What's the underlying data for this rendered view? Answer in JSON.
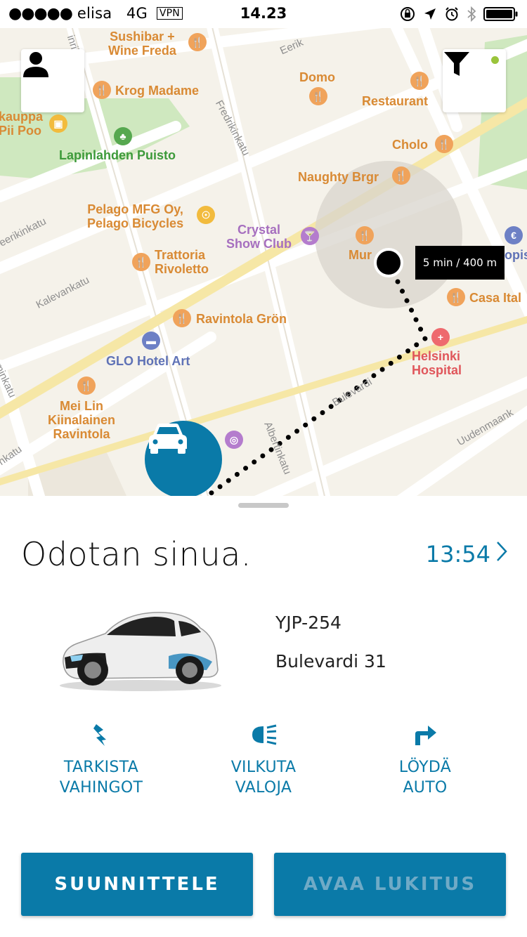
{
  "status_bar": {
    "signal": "●●●●●",
    "carrier": "elisa",
    "network": "4G",
    "vpn": "VPN",
    "time": "14.23"
  },
  "map": {
    "places": {
      "sushibar": "Sushibar +\nWine Freda",
      "krog": "Krog Madame",
      "domo": "Domo",
      "restaurant": "Restaurant",
      "kauppa": "kauppa\nPii Poo",
      "lapinlahden": "Lapinlahden Puisto",
      "cholo": "Cholo",
      "naughty": "Naughty Brgr",
      "pelago": "Pelago MFG Oy,\nPelago Bicycles",
      "crystal": "Crystal\nShow Club",
      "mur": "Mur",
      "opis": "opis",
      "trattoria": "Trattoria\nRivoletto",
      "casa": "Casa Ital",
      "ravintola_gron": "Ravintola Grön",
      "helsinki_hospital": "Helsinki\nHospital",
      "glo": "GLO Hotel Art",
      "meilin": "Mei Lin\nKiinalainen\nRavintola"
    },
    "streets": {
      "eerikinkatu_top": "Eerik",
      "fredrikinkatu": "Fredrikinkatu",
      "eerikinkatu_left": "eerikinkatu",
      "kalevankatu": "Kalevankatu",
      "albertinkatu": "Albertinkatu",
      "bulevardi": "Bulevardi",
      "uudenmaankatu": "Uudenmaank",
      "lonnrotinkatu": "nkatu",
      "minkatu": "minkatu",
      "inrii": "inrii"
    },
    "route_chip": "5 min / 400 m"
  },
  "sheet": {
    "title": "Odotan sinua.",
    "eta": "13:54",
    "plate": "YJP-254",
    "address": "Bulevardi 31",
    "actions": [
      {
        "label": "TARKISTA\nVAHINGOT",
        "icon": "damage-icon"
      },
      {
        "label": "VILKUTA\nVALOJA",
        "icon": "headlights-icon"
      },
      {
        "label": "LÖYDÄ\nAUTO",
        "icon": "turn-arrow-icon"
      }
    ],
    "plan_button": "SUUNNITTELE",
    "unlock_button": "AVAA LUKITUS"
  },
  "colors": {
    "accent": "#0a7aa8",
    "accent_disabled_text": "#6faac6",
    "map_background": "#f5f2ea",
    "park_green": "#cfe8bf",
    "highlight_road": "#f6e7a6",
    "poi_orange": "#f0a35b"
  }
}
